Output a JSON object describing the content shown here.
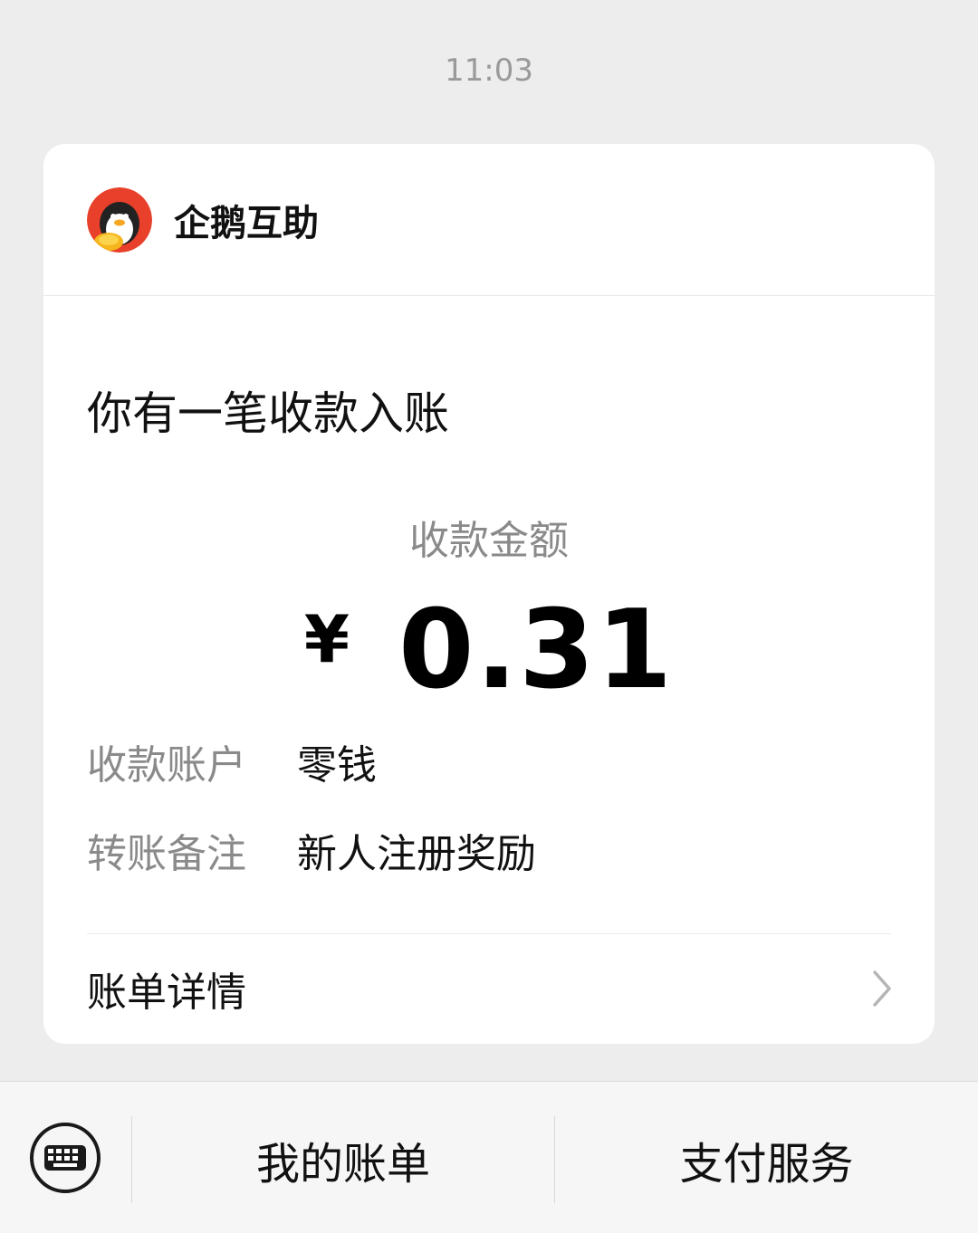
{
  "timestamp": "11:03",
  "card": {
    "sender_name": "企鹅互助",
    "headline": "你有一笔收款入账",
    "amount_label": "收款金额",
    "currency_symbol": "¥",
    "amount_value": "0.31",
    "rows": [
      {
        "label": "收款账户",
        "value": "零钱"
      },
      {
        "label": "转账备注",
        "value": "新人注册奖励"
      }
    ],
    "detail_label": "账单详情"
  },
  "bottom_bar": {
    "menu_items": [
      "我的账单",
      "支付服务"
    ]
  },
  "icons": {
    "logo": "penguin-logo-icon",
    "chevron": "chevron-right-icon",
    "keyboard": "keyboard-icon"
  },
  "colors": {
    "background": "#ededed",
    "card": "#ffffff",
    "muted_text": "#8a8a8a",
    "logo_red": "#e8402a",
    "logo_gold": "#f5b51d"
  }
}
